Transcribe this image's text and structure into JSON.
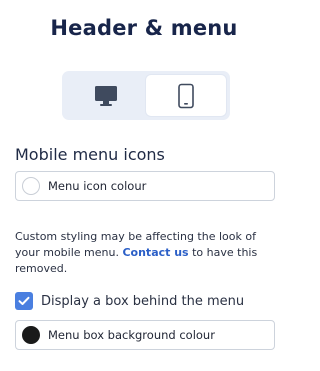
{
  "header": {
    "title": "Header & menu"
  },
  "device_toggle": {
    "options": [
      {
        "name": "desktop",
        "selected": false
      },
      {
        "name": "mobile",
        "selected": true
      }
    ]
  },
  "mobile_menu": {
    "heading": "Mobile menu icons",
    "icon_colour_label": "Menu icon colour",
    "icon_colour": "#ffffff"
  },
  "notice": {
    "text_before": "Custom styling may be affecting the look of your mobile menu.",
    "link_text": "Contact us",
    "text_after": "to have this removed."
  },
  "menu_box": {
    "checkbox_label": "Display a box behind the menu",
    "checked": true,
    "background_colour_label": "Menu box background colour",
    "background_colour": "#1a1a1a"
  },
  "colors": {
    "accent": "#4a7fe0",
    "link": "#2b5fc7",
    "toggle_bg": "#e9eef7"
  }
}
